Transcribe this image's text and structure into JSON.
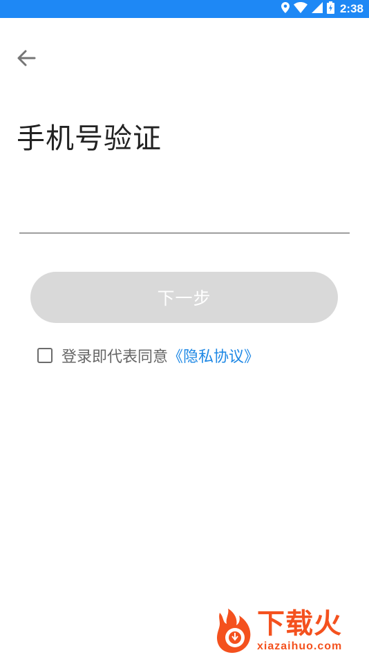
{
  "status_bar": {
    "time": "2:38",
    "icons": [
      "location-icon",
      "wifi-icon",
      "signal-icon",
      "battery-icon"
    ],
    "color": "#1e88f5"
  },
  "header": {
    "back_icon": "arrow-left-icon"
  },
  "page": {
    "title": "手机号验证"
  },
  "phone_input": {
    "value": "",
    "placeholder": ""
  },
  "next_button": {
    "label": "下一步",
    "enabled": false,
    "color": "#d9d9d9"
  },
  "agreement": {
    "checked": false,
    "text": "登录即代表同意",
    "link_text": "《隐私协议》",
    "link_color": "#1e88e5"
  },
  "watermark": {
    "brand": "下载火",
    "url": "xiazaihuo.com",
    "color": "#f4511e"
  }
}
